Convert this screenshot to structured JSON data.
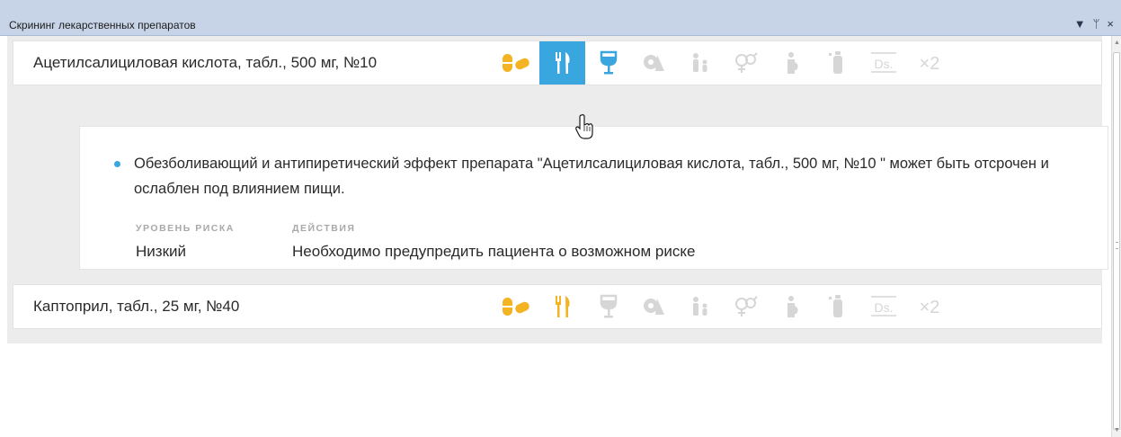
{
  "window": {
    "title": "Скрининг лекарственных препаратов",
    "controls": [
      "▼",
      "ᛘ",
      "×"
    ]
  },
  "drugs": [
    {
      "name": "Ацетилсалициловая кислота, табл., 500 мг, №10",
      "active_icon": "food-interaction",
      "icons": [
        {
          "name": "drug-interaction",
          "status": "warning"
        },
        {
          "name": "food-interaction",
          "status": "selected"
        },
        {
          "name": "alcohol-interaction",
          "status": "info"
        },
        {
          "name": "age-restriction",
          "status": "none"
        },
        {
          "name": "children-restriction",
          "status": "none"
        },
        {
          "name": "gender-restriction",
          "status": "none"
        },
        {
          "name": "pregnancy-restriction",
          "status": "none"
        },
        {
          "name": "lactation-restriction",
          "status": "none"
        },
        {
          "name": "dosage-check",
          "status": "none"
        },
        {
          "name": "duplication-check",
          "status": "none"
        }
      ]
    },
    {
      "name": "Каптоприл, табл., 25 мг, №40",
      "icons": [
        {
          "name": "drug-interaction",
          "status": "warning"
        },
        {
          "name": "food-interaction",
          "status": "warning"
        },
        {
          "name": "alcohol-interaction",
          "status": "none"
        },
        {
          "name": "age-restriction",
          "status": "none"
        },
        {
          "name": "children-restriction",
          "status": "none"
        },
        {
          "name": "gender-restriction",
          "status": "none"
        },
        {
          "name": "pregnancy-restriction",
          "status": "none"
        },
        {
          "name": "lactation-restriction",
          "status": "none"
        },
        {
          "name": "dosage-check",
          "status": "none"
        },
        {
          "name": "duplication-check",
          "status": "none"
        }
      ]
    }
  ],
  "detail": {
    "description": "Обезболивающий и антипиретический эффект препарата \"Ацетилсалициловая кислота, табл., 500 мг, №10 \" может быть отсрочен и ослаблен под влиянием пищи.",
    "risk_label": "УРОВЕНЬ РИСКА",
    "risk_value": "Низкий",
    "action_label": "ДЕЙСТВИЯ",
    "action_value": "Необходимо предупредить пациента о возможном риске"
  },
  "icon_labels": {
    "dosage": "Ds.",
    "duplication": "×2"
  },
  "colors": {
    "accent": "#3aa6df",
    "warning": "#f3b323",
    "info": "#3aa6df",
    "inactive": "#d6d6d6",
    "titlebar": "#c7d4e8"
  }
}
